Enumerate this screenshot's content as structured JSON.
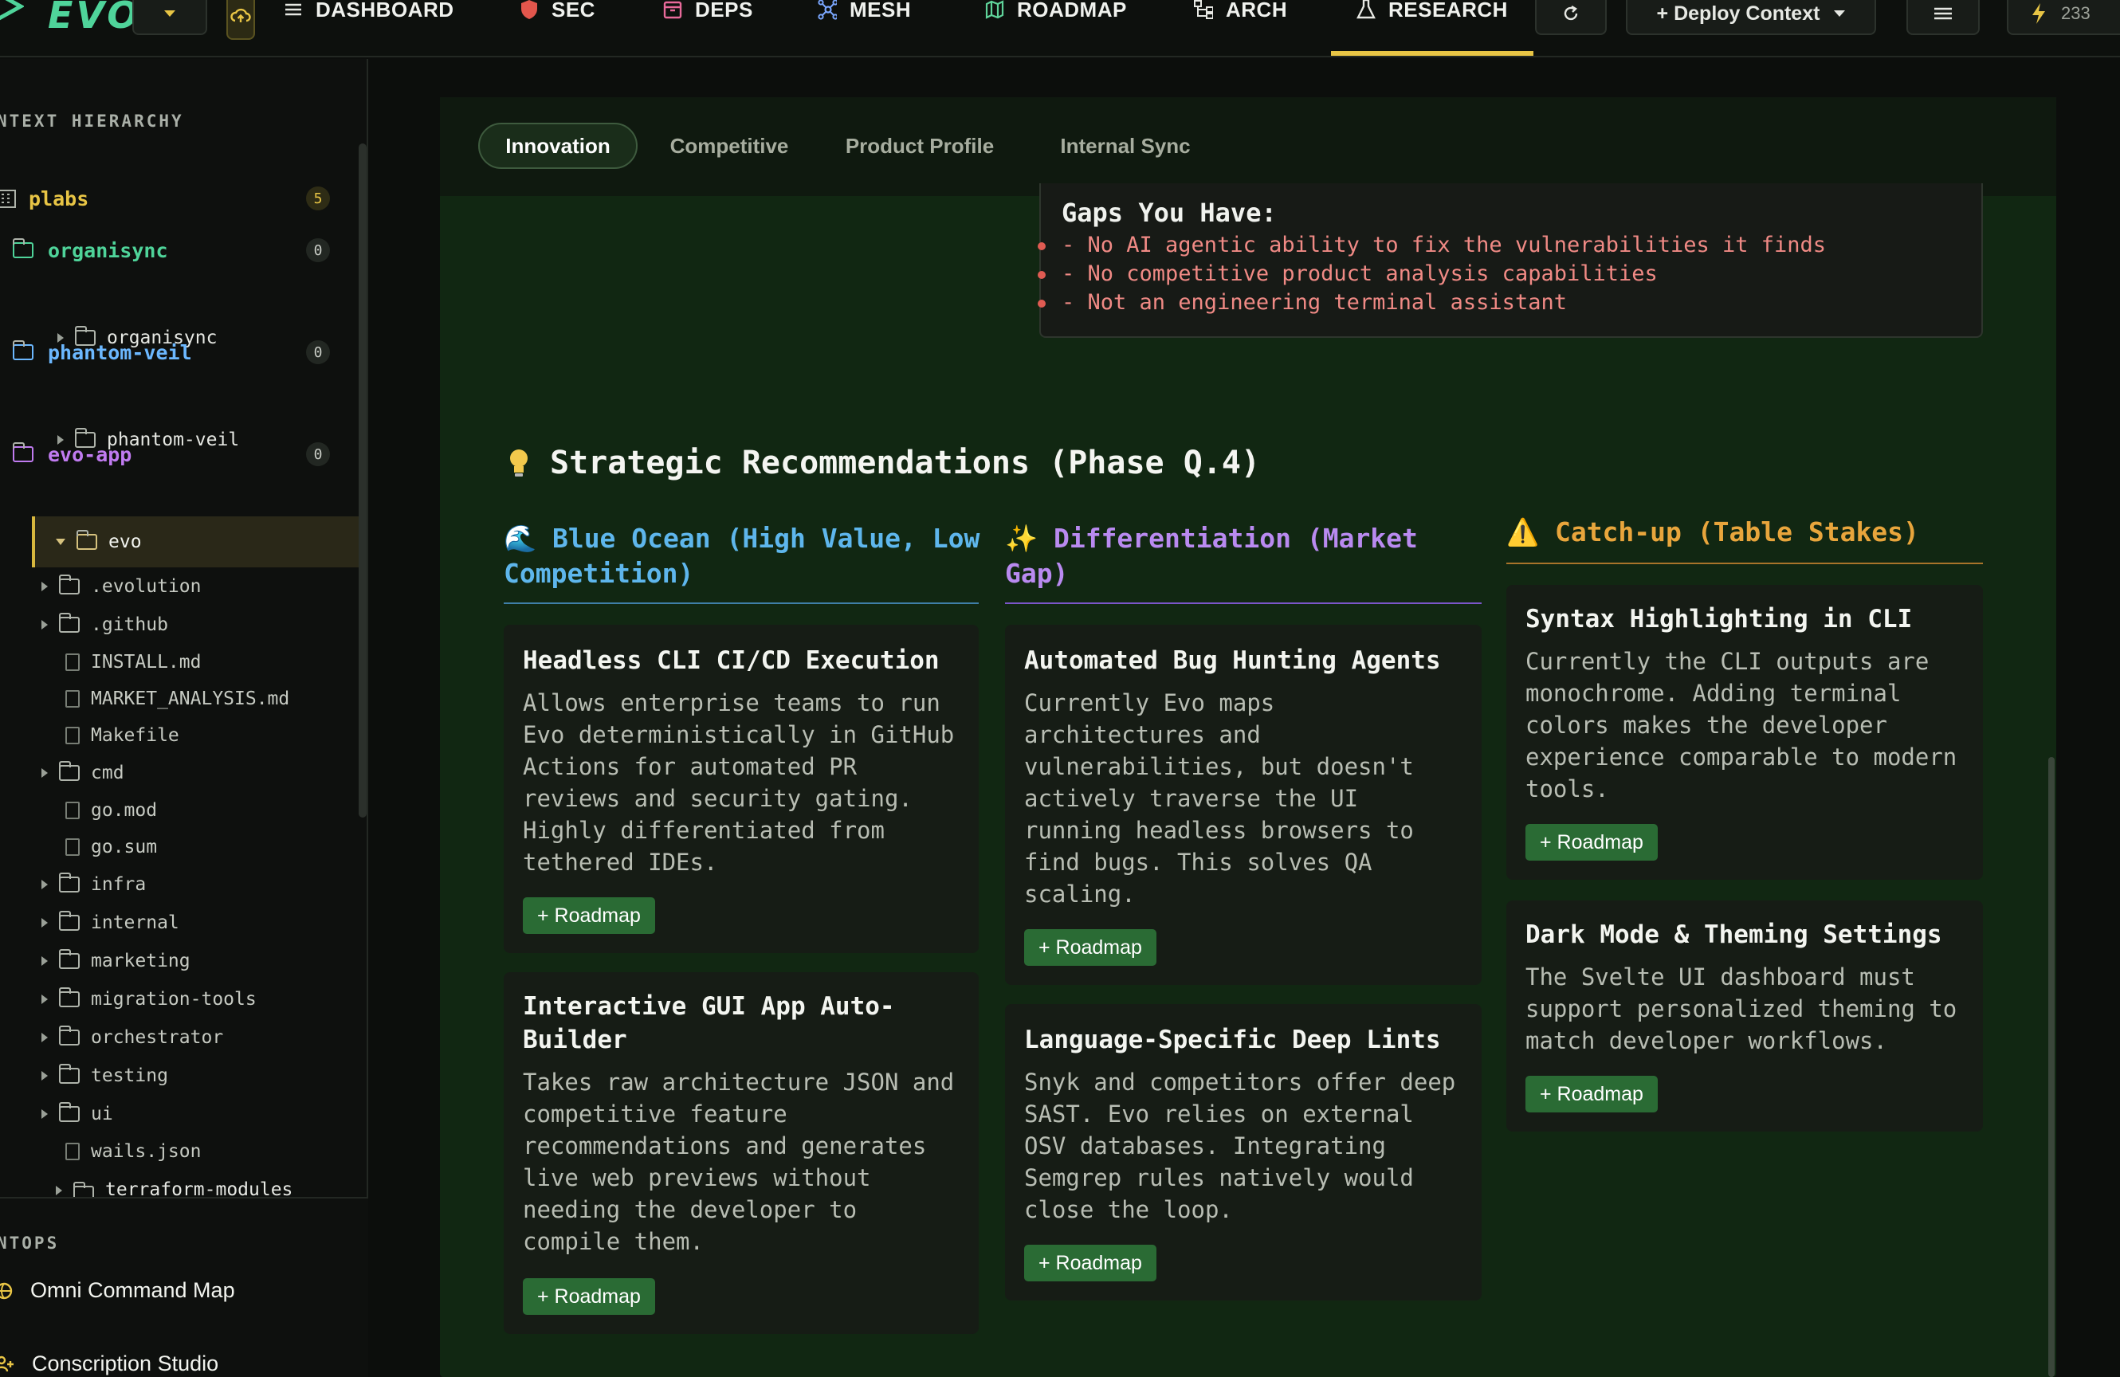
{
  "app": {
    "name": "EVO"
  },
  "nav": {
    "items": [
      {
        "label": "DASHBOARD",
        "icon": "menu-icon"
      },
      {
        "label": "SEC",
        "icon": "shield-icon"
      },
      {
        "label": "DEPS",
        "icon": "package-icon"
      },
      {
        "label": "MESH",
        "icon": "network-icon"
      },
      {
        "label": "ROADMAP",
        "icon": "map-icon"
      },
      {
        "label": "ARCH",
        "icon": "hierarchy-icon"
      },
      {
        "label": "RESEARCH",
        "icon": "flask-icon"
      }
    ],
    "active": "RESEARCH",
    "deploy_label": "+ Deploy Context",
    "counter": "233",
    "accent": "#e8c545"
  },
  "sidebar": {
    "section_title": "NTEXT HIERARCHY",
    "root": {
      "label": "plabs",
      "count": "5"
    },
    "groups": [
      {
        "label": "organisync",
        "count": "0",
        "child": "organisync",
        "color": "#4fd49a"
      },
      {
        "label": "phantom-veil",
        "count": "0",
        "child": "phantom-veil",
        "color": "#6cb8ff"
      },
      {
        "label": "evo-app",
        "count": "0",
        "child": "evo",
        "color": "#c07bf0"
      }
    ],
    "files": [
      {
        "name": ".evolution",
        "type": "folder"
      },
      {
        "name": ".github",
        "type": "folder"
      },
      {
        "name": "INSTALL.md",
        "type": "file"
      },
      {
        "name": "MARKET_ANALYSIS.md",
        "type": "file"
      },
      {
        "name": "Makefile",
        "type": "file"
      },
      {
        "name": "cmd",
        "type": "folder"
      },
      {
        "name": "go.mod",
        "type": "file"
      },
      {
        "name": "go.sum",
        "type": "file"
      },
      {
        "name": "infra",
        "type": "folder"
      },
      {
        "name": "internal",
        "type": "folder"
      },
      {
        "name": "marketing",
        "type": "folder"
      },
      {
        "name": "migration-tools",
        "type": "folder"
      },
      {
        "name": "orchestrator",
        "type": "folder"
      },
      {
        "name": "testing",
        "type": "folder"
      },
      {
        "name": "ui",
        "type": "folder"
      },
      {
        "name": "wails.json",
        "type": "file"
      }
    ],
    "cutoff_item": "terraform-modules",
    "bottom_title": "NTOPS",
    "bottom_items": [
      {
        "label": "Omni Command Map",
        "icon": "globe-icon"
      },
      {
        "label": "Conscription Studio",
        "icon": "user-plus-icon"
      }
    ]
  },
  "tabs": [
    "Innovation",
    "Competitive",
    "Product Profile",
    "Internal Sync"
  ],
  "gaps": {
    "title": "Gaps You Have:",
    "items": [
      "- No AI agentic ability to fix the vulnerabilities it finds",
      "- No competitive product analysis capabilities",
      "- Not an engineering terminal assistant"
    ]
  },
  "strategy": {
    "title": "Strategic Recommendations (Phase Q.4)",
    "columns": [
      {
        "heading_line1": "🌊 Blue Ocean (High Value, Low",
        "heading_line2": "Competition)",
        "color": "#5eb6ec",
        "cards": [
          {
            "title_l1": "Headless CLI CI/CD Execution",
            "title_l2": "",
            "body": [
              "Allows enterprise teams to run",
              "Evo deterministically in GitHub",
              "Actions for automated PR",
              "reviews and security gating.",
              "Highly differentiated from",
              "tethered IDEs."
            ],
            "button": "+ Roadmap"
          },
          {
            "title_l1": "Interactive GUI App Auto-",
            "title_l2": "Builder",
            "body": [
              "Takes raw architecture JSON and",
              "competitive feature",
              "recommendations and generates",
              "live web previews without",
              "needing the developer to",
              "compile them."
            ],
            "button": "+ Roadmap"
          }
        ]
      },
      {
        "heading_line1": "✨ Differentiation (Market",
        "heading_line2": "Gap)",
        "color": "#b98af0",
        "cards": [
          {
            "title_l1": "Automated Bug Hunting Agents",
            "title_l2": "",
            "body": [
              "Currently Evo maps",
              "architectures and",
              "vulnerabilities, but doesn't",
              "actively traverse the UI",
              "running headless browsers to",
              "find bugs. This solves QA",
              "scaling."
            ],
            "button": "+ Roadmap"
          },
          {
            "title_l1": "Language-Specific Deep Lints",
            "title_l2": "",
            "body": [
              "Snyk and competitors offer deep",
              "SAST. Evo relies on external",
              "OSV databases. Integrating",
              "Semgrep rules natively would",
              "close the loop."
            ],
            "button": "+ Roadmap"
          }
        ]
      },
      {
        "heading_line1": "⚠️ Catch-up (Table Stakes)",
        "heading_line2": "",
        "color": "#e8a53c",
        "cards": [
          {
            "title_l1": "Syntax Highlighting in CLI",
            "title_l2": "",
            "body": [
              "Currently the CLI outputs are",
              "monochrome. Adding terminal",
              "colors makes the developer",
              "experience comparable to modern",
              "tools."
            ],
            "button": "+ Roadmap"
          },
          {
            "title_l1": "Dark Mode & Theming Settings",
            "title_l2": "",
            "body": [
              "The Svelte UI dashboard must",
              "support personalized theming to",
              "match developer workflows."
            ],
            "button": "+ Roadmap"
          }
        ]
      }
    ]
  }
}
